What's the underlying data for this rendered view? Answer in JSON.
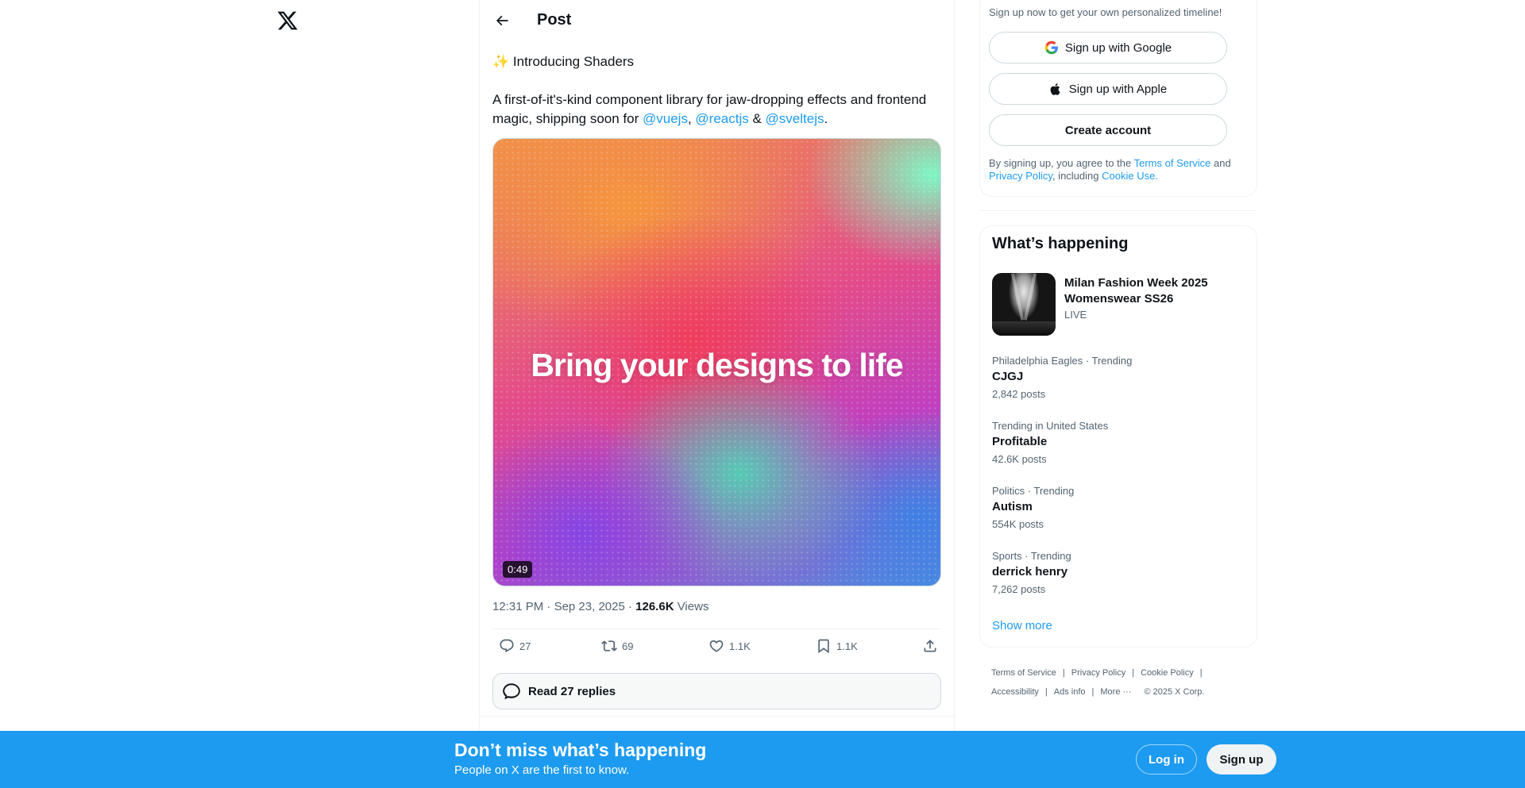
{
  "nav": {
    "logo_icon": "x-logo-icon"
  },
  "post_header": {
    "title": "Post",
    "back_icon": "arrow-left-icon"
  },
  "post": {
    "title_emoji": "✨",
    "title": "Introducing Shaders",
    "body_text_1": "A first-of-it's-kind component library for jaw-dropping effects and frontend magic, shipping soon for ",
    "mention_1": "@vuejs",
    "sep_1": ", ",
    "mention_2": "@reactjs",
    "sep_2": " & ",
    "mention_3": "@sveltejs",
    "body_end": ".",
    "media": {
      "overlay_text": "Bring your designs to life",
      "duration": "0:49"
    },
    "time": "12:31 PM",
    "dot": " · ",
    "date": "Sep 23, 2025",
    "views_count": "126.6K",
    "views_label": " Views",
    "replies_count": "27",
    "reposts_count": "69",
    "likes_count": "1.1K",
    "bookmarks_count": "1.1K",
    "read_replies_label": "Read 27 replies"
  },
  "signup": {
    "prompt": "Sign up now to get your own personalized timeline!",
    "google_label": "Sign up with Google",
    "apple_label": "Sign up with Apple",
    "create_label": "Create account",
    "legal_1": "By signing up, you agree to the ",
    "terms_link": "Terms of Service",
    "legal_2": " and ",
    "privacy_link": "Privacy Policy",
    "legal_3": ", including ",
    "cookie_link": "Cookie Use.",
    "legal_4": ""
  },
  "happening": {
    "title": "What’s happening",
    "live": {
      "title": "Milan Fashion Week 2025 Womenswear SS26",
      "badge": "LIVE"
    },
    "trends": [
      {
        "category": "Philadelphia Eagles · Trending",
        "name": "CJGJ",
        "count": "2,842 posts"
      },
      {
        "category": "Trending in United States",
        "name": "Profitable",
        "count": "42.6K posts"
      },
      {
        "category": "Politics · Trending",
        "name": "Autism",
        "count": "554K posts"
      },
      {
        "category": "Sports · Trending",
        "name": "derrick henry",
        "count": "7,262 posts"
      }
    ],
    "show_more": "Show more"
  },
  "footer": {
    "terms": "Terms of Service",
    "privacy": "Privacy Policy",
    "cookie": "Cookie Policy",
    "accessibility": "Accessibility",
    "ads": "Ads info",
    "more": "More ···",
    "copyright": "© 2025 X Corp.",
    "sep": "|"
  },
  "banner": {
    "title": "Don’t miss what’s happening",
    "subtitle": "People on X are the first to know.",
    "login_label": "Log in",
    "signup_label": "Sign up"
  },
  "colors": {
    "accent": "#1d9bf0",
    "text": "#0f1419",
    "muted": "#536471",
    "border": "#eff3f4"
  }
}
